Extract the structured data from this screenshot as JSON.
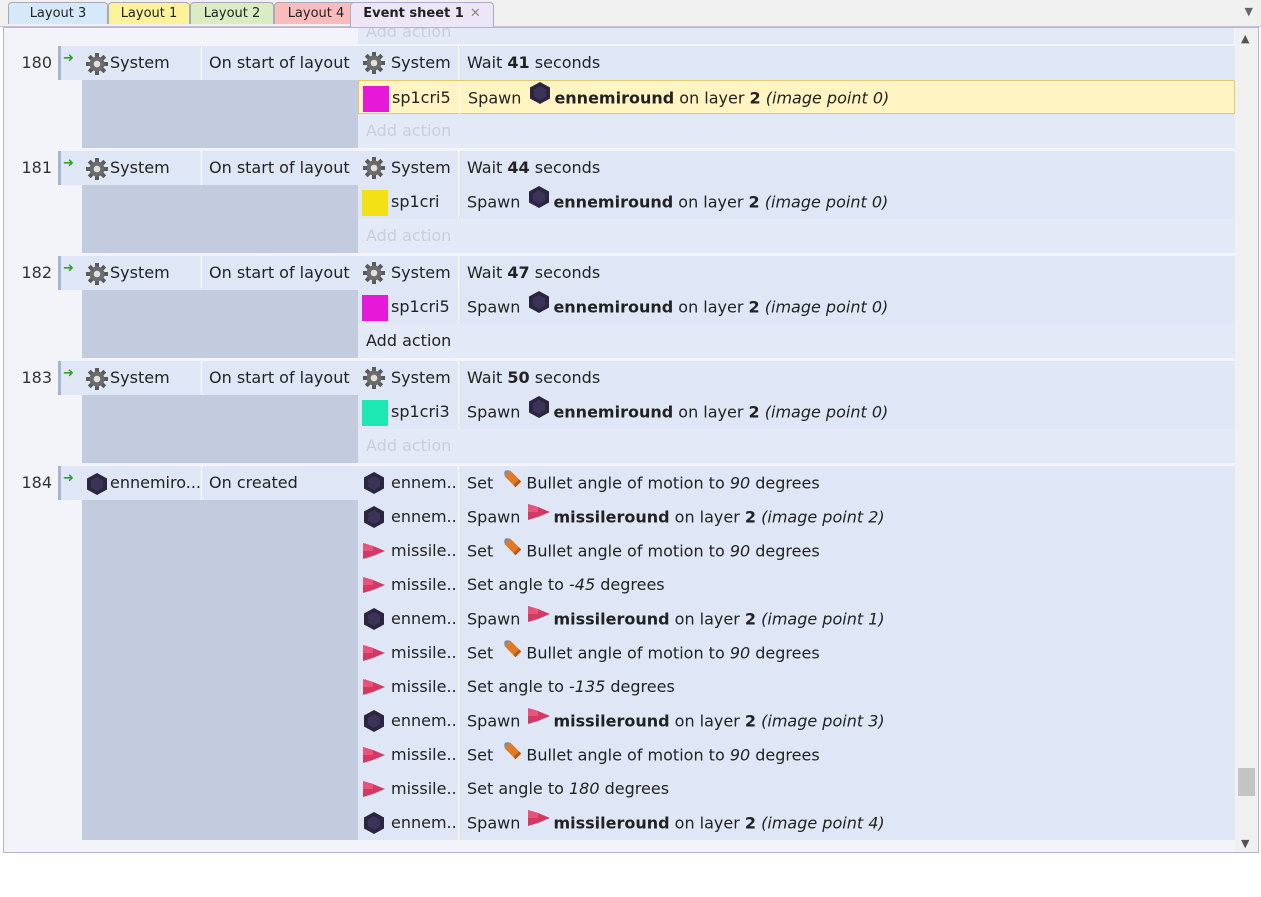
{
  "tabs": [
    {
      "label": "Layout 3",
      "color": "#d6e9fb"
    },
    {
      "label": "Layout 1",
      "color": "#fbf29a"
    },
    {
      "label": "Layout 2",
      "color": "#d9ecc2"
    },
    {
      "label": "Layout 4",
      "color": "#f8bcbc"
    },
    {
      "label": "Event sheet 1",
      "color": "#ece6f6",
      "active": true
    }
  ],
  "tab_close": "✕",
  "scroll_position_fraction": 0.95,
  "top_add_action": "Add action",
  "colors": {
    "sp1cri5": "#e619d8",
    "sp1cri": "#f3e116",
    "sp1cri3": "#1de8b2"
  },
  "events": [
    {
      "number": "180",
      "condition": {
        "object": "System",
        "text": "On start of layout",
        "icon": "gear-icon"
      },
      "actions": [
        {
          "icon": "gear-icon",
          "object": "System",
          "parts": [
            [
              "t",
              "Wait "
            ],
            [
              "b",
              "41"
            ],
            [
              "t",
              " seconds"
            ]
          ]
        },
        {
          "icon": "color-square-magenta",
          "object": "sp1cri5",
          "selected": true,
          "parts": [
            [
              "t",
              "Spawn "
            ],
            [
              "icon",
              "enemy-icon"
            ],
            [
              "b",
              "ennemiround"
            ],
            [
              "t",
              " on layer "
            ],
            [
              "b",
              "2"
            ],
            [
              "t",
              " "
            ],
            [
              "i",
              "(image point 0)"
            ]
          ]
        }
      ],
      "add_action": "Add action",
      "add_action_dim": true
    },
    {
      "number": "181",
      "condition": {
        "object": "System",
        "text": "On start of layout",
        "icon": "gear-icon"
      },
      "actions": [
        {
          "icon": "gear-icon",
          "object": "System",
          "parts": [
            [
              "t",
              "Wait "
            ],
            [
              "b",
              "44"
            ],
            [
              "t",
              " seconds"
            ]
          ]
        },
        {
          "icon": "color-square-yellow",
          "object": "sp1cri",
          "parts": [
            [
              "t",
              "Spawn "
            ],
            [
              "icon",
              "enemy-icon"
            ],
            [
              "b",
              "ennemiround"
            ],
            [
              "t",
              " on layer "
            ],
            [
              "b",
              "2"
            ],
            [
              "t",
              " "
            ],
            [
              "i",
              "(image point 0)"
            ]
          ]
        }
      ],
      "add_action": "Add action",
      "add_action_dim": true
    },
    {
      "number": "182",
      "condition": {
        "object": "System",
        "text": "On start of layout",
        "icon": "gear-icon"
      },
      "actions": [
        {
          "icon": "gear-icon",
          "object": "System",
          "parts": [
            [
              "t",
              "Wait "
            ],
            [
              "b",
              "47"
            ],
            [
              "t",
              " seconds"
            ]
          ]
        },
        {
          "icon": "color-square-magenta",
          "object": "sp1cri5",
          "parts": [
            [
              "t",
              "Spawn "
            ],
            [
              "icon",
              "enemy-icon"
            ],
            [
              "b",
              "ennemiround"
            ],
            [
              "t",
              " on layer "
            ],
            [
              "b",
              "2"
            ],
            [
              "t",
              " "
            ],
            [
              "i",
              "(image point 0)"
            ]
          ]
        }
      ],
      "add_action": "Add action",
      "add_action_dim": false
    },
    {
      "number": "183",
      "condition": {
        "object": "System",
        "text": "On start of layout",
        "icon": "gear-icon"
      },
      "actions": [
        {
          "icon": "gear-icon",
          "object": "System",
          "parts": [
            [
              "t",
              "Wait "
            ],
            [
              "b",
              "50"
            ],
            [
              "t",
              " seconds"
            ]
          ]
        },
        {
          "icon": "color-square-teal",
          "object": "sp1cri3",
          "parts": [
            [
              "t",
              "Spawn "
            ],
            [
              "icon",
              "enemy-icon"
            ],
            [
              "b",
              "ennemiround"
            ],
            [
              "t",
              " on layer "
            ],
            [
              "b",
              "2"
            ],
            [
              "t",
              " "
            ],
            [
              "i",
              "(image point 0)"
            ]
          ]
        }
      ],
      "add_action": "Add action",
      "add_action_dim": true
    },
    {
      "number": "184",
      "condition": {
        "object": "ennemiro...",
        "text": "On created",
        "icon": "enemy-icon"
      },
      "actions": [
        {
          "icon": "enemy-icon",
          "object": "ennem...",
          "parts": [
            [
              "t",
              "Set "
            ],
            [
              "icon",
              "bullet-icon"
            ],
            [
              "t",
              "Bullet angle of motion to "
            ],
            [
              "i",
              "90"
            ],
            [
              "t",
              " degrees"
            ]
          ]
        },
        {
          "icon": "enemy-icon",
          "object": "ennem...",
          "parts": [
            [
              "t",
              "Spawn "
            ],
            [
              "icon",
              "missile-icon"
            ],
            [
              "b",
              "missileround"
            ],
            [
              "t",
              " on layer "
            ],
            [
              "b",
              "2"
            ],
            [
              "t",
              " "
            ],
            [
              "i",
              "(image point 2)"
            ]
          ]
        },
        {
          "icon": "missile-icon",
          "object": "missile...",
          "parts": [
            [
              "t",
              "Set "
            ],
            [
              "icon",
              "bullet-icon"
            ],
            [
              "t",
              "Bullet angle of motion to "
            ],
            [
              "i",
              "90"
            ],
            [
              "t",
              " degrees"
            ]
          ]
        },
        {
          "icon": "missile-icon",
          "object": "missile...",
          "parts": [
            [
              "t",
              "Set angle to "
            ],
            [
              "i",
              "-45"
            ],
            [
              "t",
              " degrees"
            ]
          ]
        },
        {
          "icon": "enemy-icon",
          "object": "ennem...",
          "parts": [
            [
              "t",
              "Spawn "
            ],
            [
              "icon",
              "missile-icon"
            ],
            [
              "b",
              "missileround"
            ],
            [
              "t",
              " on layer "
            ],
            [
              "b",
              "2"
            ],
            [
              "t",
              " "
            ],
            [
              "i",
              "(image point 1)"
            ]
          ]
        },
        {
          "icon": "missile-icon",
          "object": "missile...",
          "parts": [
            [
              "t",
              "Set "
            ],
            [
              "icon",
              "bullet-icon"
            ],
            [
              "t",
              "Bullet angle of motion to "
            ],
            [
              "i",
              "90"
            ],
            [
              "t",
              " degrees"
            ]
          ]
        },
        {
          "icon": "missile-icon",
          "object": "missile...",
          "parts": [
            [
              "t",
              "Set angle to "
            ],
            [
              "i",
              "-135"
            ],
            [
              "t",
              " degrees"
            ]
          ]
        },
        {
          "icon": "enemy-icon",
          "object": "ennem...",
          "parts": [
            [
              "t",
              "Spawn "
            ],
            [
              "icon",
              "missile-icon"
            ],
            [
              "b",
              "missileround"
            ],
            [
              "t",
              " on layer "
            ],
            [
              "b",
              "2"
            ],
            [
              "t",
              " "
            ],
            [
              "i",
              "(image point 3)"
            ]
          ]
        },
        {
          "icon": "missile-icon",
          "object": "missile...",
          "parts": [
            [
              "t",
              "Set "
            ],
            [
              "icon",
              "bullet-icon"
            ],
            [
              "t",
              "Bullet angle of motion to "
            ],
            [
              "i",
              "90"
            ],
            [
              "t",
              " degrees"
            ]
          ]
        },
        {
          "icon": "missile-icon",
          "object": "missile...",
          "parts": [
            [
              "t",
              "Set angle to "
            ],
            [
              "i",
              "180"
            ],
            [
              "t",
              " degrees"
            ]
          ]
        },
        {
          "icon": "enemy-icon",
          "object": "ennem...",
          "parts": [
            [
              "t",
              "Spawn "
            ],
            [
              "icon",
              "missile-icon"
            ],
            [
              "b",
              "missileround"
            ],
            [
              "t",
              " on layer "
            ],
            [
              "b",
              "2"
            ],
            [
              "t",
              " "
            ],
            [
              "i",
              "(image point 4)"
            ]
          ]
        }
      ]
    }
  ]
}
